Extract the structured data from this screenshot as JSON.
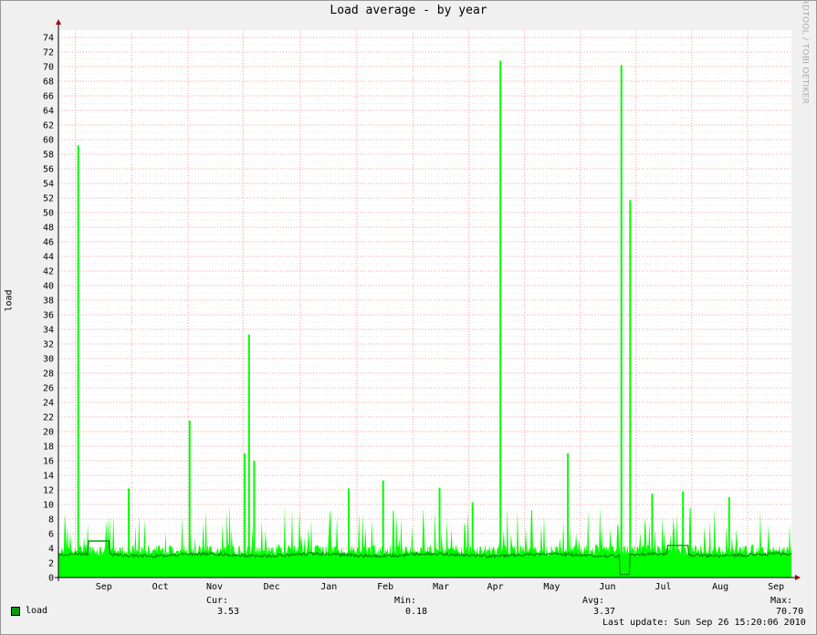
{
  "chart_data": {
    "type": "area",
    "title": "Load average - by year",
    "ylabel": "load",
    "xlabel": "",
    "ylim": [
      0,
      75
    ],
    "grid": true,
    "y_ticks": [
      0,
      2,
      4,
      6,
      8,
      10,
      12,
      14,
      16,
      18,
      20,
      22,
      24,
      26,
      28,
      30,
      32,
      34,
      36,
      38,
      40,
      42,
      44,
      46,
      48,
      50,
      52,
      54,
      56,
      58,
      60,
      62,
      64,
      66,
      68,
      70,
      72,
      74
    ],
    "x_ticks": [
      "Sep",
      "Oct",
      "Nov",
      "Dec",
      "Jan",
      "Feb",
      "Mar",
      "Apr",
      "May",
      "Jun",
      "Jul",
      "Aug",
      "Sep"
    ],
    "legend": "bottom-left",
    "series": [
      {
        "name": "load",
        "color": "#00ff00",
        "avg_color": "#0b9a0b",
        "spikes": [
          {
            "x": 0.027,
            "y": 59.2
          },
          {
            "x": 0.096,
            "y": 12.2
          },
          {
            "x": 0.179,
            "y": 21.5
          },
          {
            "x": 0.254,
            "y": 17.0
          },
          {
            "x": 0.26,
            "y": 33.3
          },
          {
            "x": 0.267,
            "y": 16.0
          },
          {
            "x": 0.396,
            "y": 12.2
          },
          {
            "x": 0.443,
            "y": 13.3
          },
          {
            "x": 0.52,
            "y": 12.3
          },
          {
            "x": 0.565,
            "y": 10.3
          },
          {
            "x": 0.603,
            "y": 70.8
          },
          {
            "x": 0.695,
            "y": 17.0
          },
          {
            "x": 0.768,
            "y": 70.2
          },
          {
            "x": 0.78,
            "y": 51.7
          },
          {
            "x": 0.81,
            "y": 11.5
          },
          {
            "x": 0.852,
            "y": 11.8
          },
          {
            "x": 0.915,
            "y": 11.0
          }
        ]
      }
    ]
  },
  "legend": {
    "label": "load"
  },
  "stats": {
    "cur_label": "Cur:",
    "cur_value": "3.53",
    "min_label": "Min:",
    "min_value": "0.18",
    "avg_label": "Avg:",
    "avg_value": "3.37",
    "max_label": "Max:",
    "max_value": "70.70"
  },
  "last_update": "Last update: Sun Sep 26 15:20:06 2010",
  "watermark": "RRDTOOL / TOBI OETIKER",
  "colors": {
    "background": "#f0f0f0",
    "plot": "#ffffff",
    "grid_minor": "#e0e0e0",
    "grid_major": "#ff9a9a",
    "series": "#00ff00",
    "avg": "#0b9a0b"
  }
}
